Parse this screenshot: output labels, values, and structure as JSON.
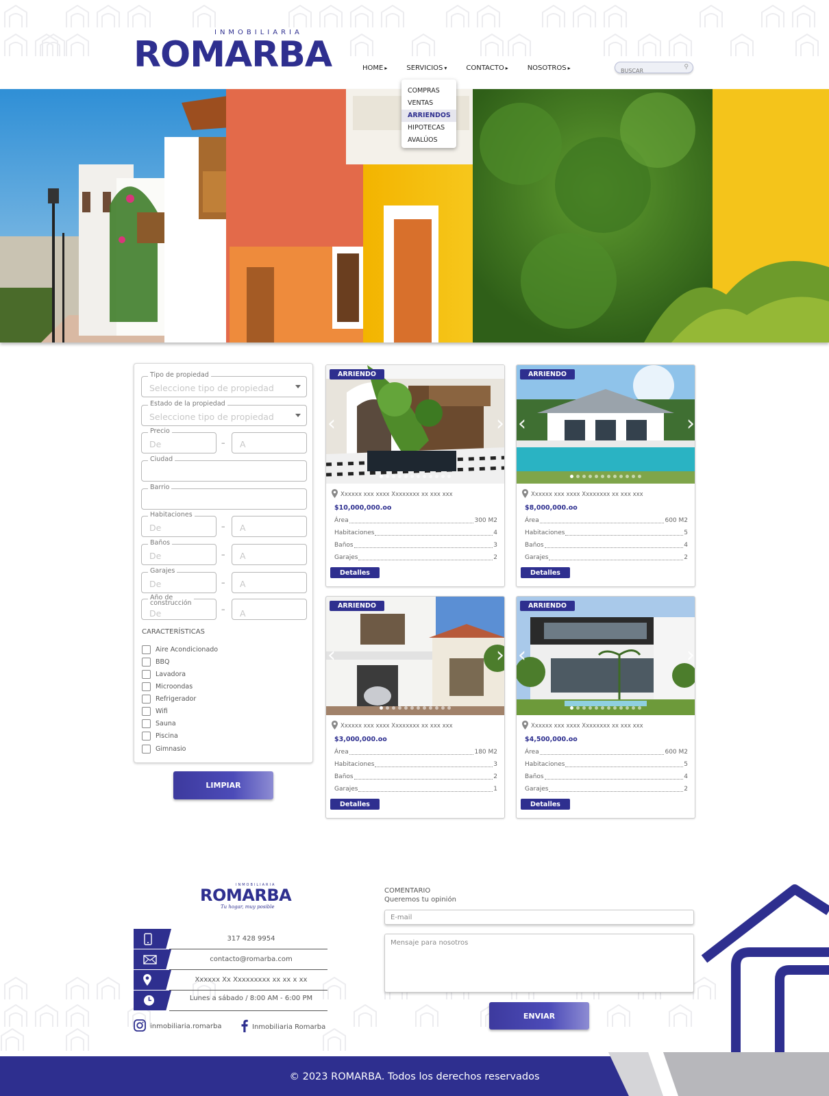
{
  "brand": {
    "tagline": "INMOBILIARIA",
    "name": "ROMARBA",
    "footer_slogan": "Tu hogar, muy posible"
  },
  "nav": {
    "items": [
      {
        "label": "HOME",
        "caret": "▸"
      },
      {
        "label": "SERVICIOS",
        "caret": "▾"
      },
      {
        "label": "CONTACTO",
        "caret": "▸"
      },
      {
        "label": "NOSOTROS",
        "caret": "▸"
      }
    ],
    "search_placeholder": "BUSCAR"
  },
  "services_menu": {
    "items": [
      "COMPRAS",
      "VENTAS",
      "ARRIENDOS",
      "HIPOTECAS",
      "AVALÚOS"
    ],
    "active": "ARRIENDOS"
  },
  "filter": {
    "tipo": {
      "label": "Tipo de propiedad",
      "placeholder": "Seleccione tipo de propiedad"
    },
    "estado": {
      "label": "Estado de la propiedad",
      "placeholder": "Seleccione tipo de propiedad"
    },
    "precio": {
      "label": "Precio",
      "from": "De",
      "to": "A"
    },
    "ciudad": {
      "label": "Ciudad"
    },
    "barrio": {
      "label": "Barrio"
    },
    "habitaciones": {
      "label": "Habitaciones",
      "from": "De",
      "to": "A"
    },
    "banos": {
      "label": "Baños",
      "from": "De",
      "to": "A"
    },
    "garajes": {
      "label": "Garajes",
      "from": "De",
      "to": "A"
    },
    "anio": {
      "label_1": "Año de",
      "label_2": "construcción",
      "from": "De",
      "to": "A"
    },
    "range_sep": "–",
    "features_title": "CARACTERÍSTICAS",
    "features": [
      "Aire Acondicionado",
      "BBQ",
      "Lavadora",
      "Microondas",
      "Refrigerador",
      "Wifi",
      "Sauna",
      "Piscina",
      "Gimnasio"
    ],
    "clear_label": "LIMPIAR"
  },
  "listings": [
    {
      "badge": "ARRIENDO",
      "address": "Xxxxxx xxx xxxx Xxxxxxxx xx xxx xxx",
      "price": "$10,000,000.oo",
      "specs": [
        {
          "label": "Área",
          "value": "300 M2"
        },
        {
          "label": "Habitaciones",
          "value": "4"
        },
        {
          "label": "Baños",
          "value": "3"
        },
        {
          "label": "Garajes",
          "value": "2"
        }
      ],
      "details_label": "Detalles"
    },
    {
      "badge": "ARRIENDO",
      "address": "Xxxxxx xxx xxxx Xxxxxxxx xx xxx xxx",
      "price": "$8,000,000.oo",
      "specs": [
        {
          "label": "Área",
          "value": "600 M2"
        },
        {
          "label": "Habitaciones",
          "value": "5"
        },
        {
          "label": "Baños",
          "value": "4"
        },
        {
          "label": "Garajes",
          "value": "2"
        }
      ],
      "details_label": "Detalles"
    },
    {
      "badge": "ARRIENDO",
      "address": "Xxxxxx xxx xxxx Xxxxxxxx xx xxx xxx",
      "price": "$3,000,000.oo",
      "specs": [
        {
          "label": "Área",
          "value": "180 M2"
        },
        {
          "label": "Habitaciones",
          "value": "3"
        },
        {
          "label": "Baños",
          "value": "2"
        },
        {
          "label": "Garajes",
          "value": "1"
        }
      ],
      "details_label": "Detalles"
    },
    {
      "badge": "ARRIENDO",
      "address": "Xxxxxx xxx xxxx Xxxxxxxx xx xxx xxx",
      "price": "$4,500,000.oo",
      "specs": [
        {
          "label": "Área",
          "value": "600 M2"
        },
        {
          "label": "Habitaciones",
          "value": "5"
        },
        {
          "label": "Baños",
          "value": "4"
        },
        {
          "label": "Garajes",
          "value": "2"
        }
      ],
      "details_label": "Detalles"
    }
  ],
  "contact": {
    "phone": "317 428 9954",
    "email": "contacto@romarba.com",
    "address": "Xxxxxx Xx Xxxxxxxxx xx xx x xx",
    "hours": "Lunes a sábado / 8:00 AM - 6:00 PM",
    "instagram": "inmobiliaria.romarba",
    "facebook": "Inmobiliaria Romarba"
  },
  "comment_form": {
    "title": "COMENTARIO",
    "subtitle": "Queremos tu opinión",
    "email_placeholder": "E-mail",
    "message_placeholder": "Mensaje para nosotros",
    "submit_label": "ENVIAR"
  },
  "footer": {
    "copyright": "© 2023 ROMARBA. Todos los derechos reservados"
  },
  "colors": {
    "brand_blue": "#2e2f8f",
    "footer_gray": "#a9a9ad"
  }
}
